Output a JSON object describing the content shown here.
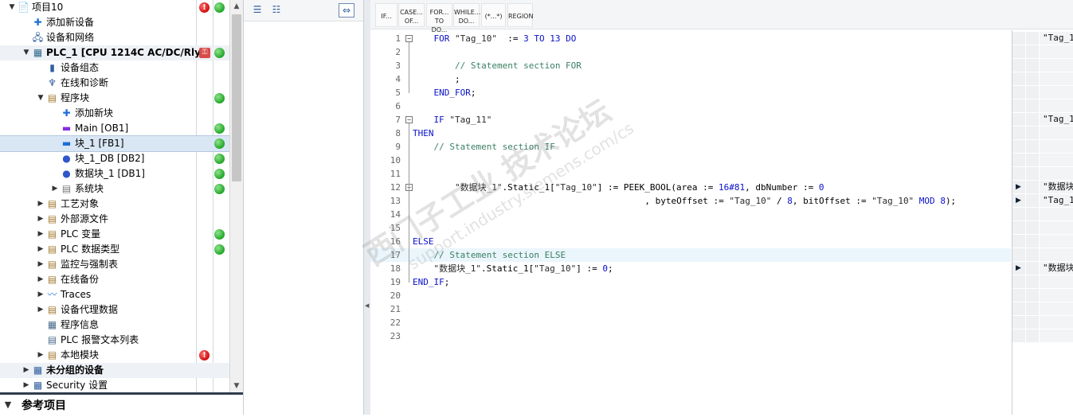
{
  "project_tree": {
    "rows": [
      {
        "label": "项目10",
        "level": 0,
        "twisty": "open",
        "icon": "project-icon",
        "status": "err-ok",
        "bold": false
      },
      {
        "label": "添加新设备",
        "level": 1,
        "twisty": "none",
        "icon": "add-device-icon",
        "status": ""
      },
      {
        "label": "设备和网络",
        "level": 1,
        "twisty": "none",
        "icon": "network-icon",
        "status": ""
      },
      {
        "label": "PLC_1 [CPU 1214C AC/DC/Rly]",
        "level": 1,
        "twisty": "open",
        "icon": "plc-icon",
        "status": "plc-ok",
        "bold": true,
        "subtle": true
      },
      {
        "label": "设备组态",
        "level": 2,
        "twisty": "none",
        "icon": "device-config-icon",
        "status": ""
      },
      {
        "label": "在线和诊断",
        "level": 2,
        "twisty": "none",
        "icon": "diagnostics-icon",
        "status": ""
      },
      {
        "label": "程序块",
        "level": 2,
        "twisty": "open",
        "icon": "folder-icon",
        "status": "ok"
      },
      {
        "label": "添加新块",
        "level": 3,
        "twisty": "none",
        "icon": "add-block-icon",
        "status": ""
      },
      {
        "label": "Main [OB1]",
        "level": 3,
        "twisty": "none",
        "icon": "ob-icon",
        "status": "ok"
      },
      {
        "label": "块_1 [FB1]",
        "level": 3,
        "twisty": "none",
        "icon": "fb-icon",
        "status": "ok",
        "selected": true
      },
      {
        "label": "块_1_DB [DB2]",
        "level": 3,
        "twisty": "none",
        "icon": "db-icon",
        "status": "ok"
      },
      {
        "label": "数据块_1 [DB1]",
        "level": 3,
        "twisty": "none",
        "icon": "db-icon",
        "status": "ok"
      },
      {
        "label": "系统块",
        "level": 3,
        "twisty": "closed",
        "icon": "system-block-icon",
        "status": "ok"
      },
      {
        "label": "工艺对象",
        "level": 2,
        "twisty": "closed",
        "icon": "folder-icon",
        "status": ""
      },
      {
        "label": "外部源文件",
        "level": 2,
        "twisty": "closed",
        "icon": "folder-icon",
        "status": ""
      },
      {
        "label": "PLC 变量",
        "level": 2,
        "twisty": "closed",
        "icon": "folder-icon",
        "status": "ok"
      },
      {
        "label": "PLC 数据类型",
        "level": 2,
        "twisty": "closed",
        "icon": "folder-icon",
        "status": "ok"
      },
      {
        "label": "监控与强制表",
        "level": 2,
        "twisty": "closed",
        "icon": "folder-icon",
        "status": ""
      },
      {
        "label": "在线备份",
        "level": 2,
        "twisty": "closed",
        "icon": "folder-icon",
        "status": ""
      },
      {
        "label": "Traces",
        "level": 2,
        "twisty": "closed",
        "icon": "traces-icon",
        "status": ""
      },
      {
        "label": "设备代理数据",
        "level": 2,
        "twisty": "closed",
        "icon": "folder-icon",
        "status": ""
      },
      {
        "label": "程序信息",
        "level": 2,
        "twisty": "none",
        "icon": "info-icon",
        "status": ""
      },
      {
        "label": "PLC 报警文本列表",
        "level": 2,
        "twisty": "none",
        "icon": "alarm-list-icon",
        "status": ""
      },
      {
        "label": "本地模块",
        "level": 2,
        "twisty": "closed",
        "icon": "folder-icon",
        "status": "err"
      },
      {
        "label": "未分组的设备",
        "level": 1,
        "twisty": "closed",
        "icon": "ungrouped-icon",
        "status": "",
        "bold": true,
        "subtle": true
      },
      {
        "label": "Security 设置",
        "level": 1,
        "twisty": "closed",
        "icon": "security-icon",
        "status": ""
      }
    ],
    "reference_header": "参考项目"
  },
  "instruction_bar": [
    {
      "top": "IF...",
      "bottom": ""
    },
    {
      "top": "CASE...",
      "bottom": "OF..."
    },
    {
      "top": "FOR...",
      "bottom": "TO DO..."
    },
    {
      "top": "WHILE...",
      "bottom": "DO..."
    },
    {
      "top": "(*...*)",
      "bottom": ""
    },
    {
      "top": "REGION",
      "bottom": ""
    }
  ],
  "code_lines": [
    {
      "n": "1",
      "fold": "box",
      "indent": "    ",
      "parts": [
        [
          "kw",
          "FOR "
        ],
        [
          "str",
          "\"Tag_10\""
        ],
        [
          "",
          "  := "
        ],
        [
          "num",
          "3"
        ],
        [
          "kw",
          " TO "
        ],
        [
          "num",
          "13"
        ],
        [
          "kw",
          " DO"
        ]
      ]
    },
    {
      "n": "2",
      "parts": []
    },
    {
      "n": "3",
      "indent": "        ",
      "parts": [
        [
          "cmt",
          "// Statement section FOR"
        ]
      ]
    },
    {
      "n": "4",
      "indent": "        ",
      "parts": [
        [
          "",
          ";"
        ]
      ]
    },
    {
      "n": "5",
      "indent": "    ",
      "parts": [
        [
          "kw",
          "END_FOR"
        ],
        [
          "",
          ";"
        ]
      ]
    },
    {
      "n": "6",
      "parts": []
    },
    {
      "n": "7",
      "fold": "box",
      "indent": "    ",
      "parts": [
        [
          "kw",
          "IF "
        ],
        [
          "str",
          "\"Tag_11\""
        ]
      ]
    },
    {
      "n": "8",
      "parts": [
        [
          "kw",
          "THEN"
        ]
      ]
    },
    {
      "n": "9",
      "indent": "    ",
      "parts": [
        [
          "cmt",
          "// Statement section IF"
        ]
      ]
    },
    {
      "n": "10",
      "parts": []
    },
    {
      "n": "11",
      "parts": []
    },
    {
      "n": "12",
      "fold": "box",
      "indent": "        ",
      "parts": [
        [
          "str",
          "\"数据块_1\""
        ],
        [
          "",
          ".Static_1["
        ],
        [
          "str",
          "\"Tag_10\""
        ],
        [
          "",
          "] := PEEK_BOOL(area := "
        ],
        [
          "num",
          "16#81"
        ],
        [
          "",
          ", dbNumber := "
        ],
        [
          "num",
          "0"
        ]
      ]
    },
    {
      "n": "13",
      "indent": "                                            ",
      "parts": [
        [
          "",
          ", byteOffset := "
        ],
        [
          "str",
          "\"Tag_10\""
        ],
        [
          "",
          " / "
        ],
        [
          "num",
          "8"
        ],
        [
          "",
          ", bitOffset := "
        ],
        [
          "str",
          "\"Tag_10\""
        ],
        [
          "kw",
          " MOD "
        ],
        [
          "num",
          "8"
        ],
        [
          "",
          ");"
        ]
      ]
    },
    {
      "n": "14",
      "parts": []
    },
    {
      "n": "15",
      "parts": []
    },
    {
      "n": "16",
      "parts": [
        [
          "kw",
          "ELSE"
        ]
      ]
    },
    {
      "n": "17",
      "indent": "    ",
      "hl": true,
      "parts": [
        [
          "cmt",
          "// Statement section ELSE"
        ]
      ]
    },
    {
      "n": "18",
      "indent": "    ",
      "parts": [
        [
          "str",
          "\"数据块_1\""
        ],
        [
          "",
          ".Static_1["
        ],
        [
          "str",
          "\"Tag_10\""
        ],
        [
          "",
          "] := "
        ],
        [
          "num",
          "0"
        ],
        [
          "",
          ";"
        ]
      ]
    },
    {
      "n": "19",
      "parts": [
        [
          "kw",
          "END_IF"
        ],
        [
          "",
          ";"
        ]
      ]
    },
    {
      "n": "20",
      "parts": []
    },
    {
      "n": "21",
      "parts": []
    },
    {
      "n": "22",
      "parts": []
    },
    {
      "n": "23",
      "parts": []
    }
  ],
  "watch_cells": [
    {
      "row": 0,
      "text": "\"Tag_1",
      "play": false
    },
    {
      "row": 6,
      "text": "\"Tag_1",
      "play": false
    },
    {
      "row": 11,
      "text": "\"数据块",
      "play": true
    },
    {
      "row": 12,
      "text": "\"Tag_1",
      "play": true
    },
    {
      "row": 17,
      "text": "\"数据块",
      "play": true
    }
  ],
  "watermark": {
    "line1": "西门子工业 技术论坛",
    "line2": "support.industry.siemens.com/cs"
  },
  "colors": {
    "accent": "#0a10c8",
    "comment": "#3a7f63",
    "ok": "#22a52a",
    "error": "#d10f0f"
  }
}
